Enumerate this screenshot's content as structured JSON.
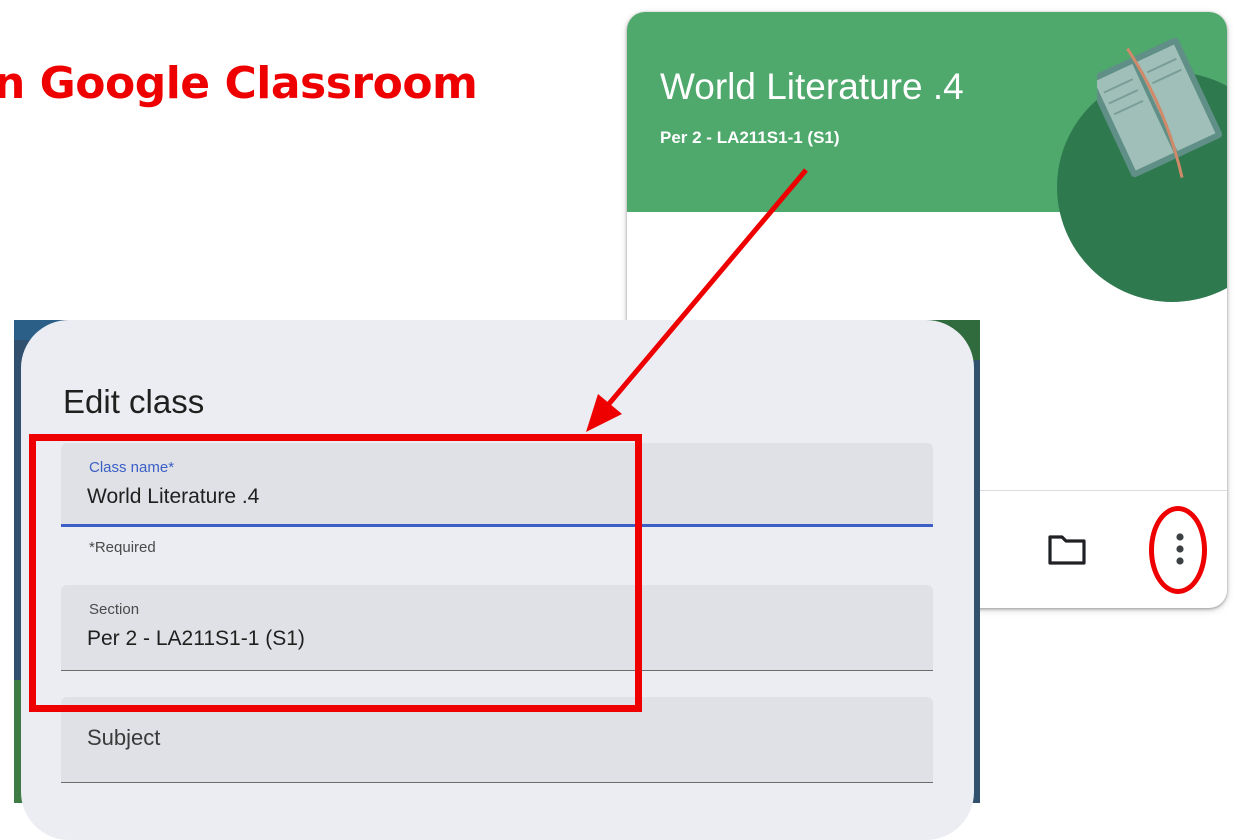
{
  "heading": "n Google Classroom",
  "card": {
    "title": "World Literature .4",
    "section": "Per 2 - LA211S1-1 (S1)",
    "folder_icon": "folder-icon",
    "more_icon": "more-vert-icon",
    "banner_color": "#4fa86c"
  },
  "dialog": {
    "title": "Edit class",
    "class_name": {
      "label": "Class name*",
      "value": "World Literature .4",
      "helper": "*Required"
    },
    "section": {
      "label": "Section",
      "value": "Per 2 - LA211S1-1 (S1)"
    },
    "subject": {
      "placeholder": "Subject"
    }
  },
  "annotation_color": "#ee0000",
  "accent_color": "#3b5fc6"
}
